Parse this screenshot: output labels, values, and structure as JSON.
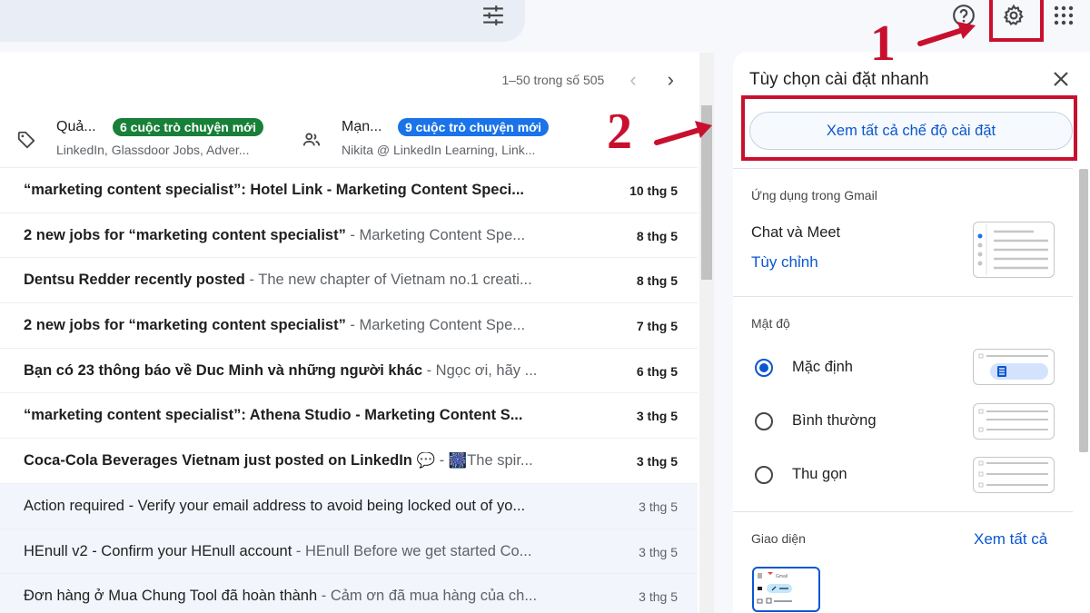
{
  "toolbar": {
    "icons": [
      "tune-icon",
      "help-icon",
      "gear-icon",
      "apps-icon"
    ]
  },
  "annotations": {
    "step1": "1",
    "step2": "2",
    "color": "#c8102e"
  },
  "mail": {
    "pager": "1–50 trong số 505",
    "categories": [
      {
        "icon": "tag-icon",
        "title": "Quả...",
        "badge": "6 cuộc trò chuyện mới",
        "badge_color": "#188038",
        "sub": "LinkedIn, Glassdoor Jobs, Adver..."
      },
      {
        "icon": "people-icon",
        "title": "Mạn...",
        "badge": "9 cuộc trò chuyện mới",
        "badge_color": "#1a73e8",
        "sub": "Nikita @ LinkedIn Learning, Link..."
      }
    ],
    "rows": [
      {
        "subject": "“marketing content specialist”: Hotel Link - Marketing Content Speci...",
        "snippet": "",
        "date": "10 thg 5",
        "unread": true
      },
      {
        "subject": "2 new jobs for “marketing content specialist”",
        "snippet": " - Marketing Content Spe...",
        "date": "8 thg 5",
        "unread": true
      },
      {
        "subject": "Dentsu Redder recently posted",
        "snippet": " - The new chapter of Vietnam no.1 creati...",
        "date": "8 thg 5",
        "unread": true
      },
      {
        "subject": "2 new jobs for “marketing content specialist”",
        "snippet": " - Marketing Content Spe...",
        "date": "7 thg 5",
        "unread": true
      },
      {
        "subject": "Bạn có 23 thông báo về Duc Minh và những người khác",
        "snippet": " - Ngọc ơi, hãy ...",
        "date": "6 thg 5",
        "unread": true
      },
      {
        "subject": "“marketing content specialist”: Athena Studio - Marketing Content S...",
        "snippet": "",
        "date": "3 thg 5",
        "unread": true
      },
      {
        "subject": "Coca-Cola Beverages Vietnam just posted on LinkedIn 💬",
        "snippet": " - 🎆The spir...",
        "date": "3 thg 5",
        "unread": true
      },
      {
        "subject": "Action required - Verify your email address to avoid being locked out of yo...",
        "snippet": "",
        "date": "3 thg 5",
        "unread": false
      },
      {
        "subject": "HEnull v2 - Confirm your HEnull account",
        "snippet": " - HEnull Before we get started Co...",
        "date": "3 thg 5",
        "unread": false
      },
      {
        "subject": "Đơn hàng ở Mua Chung Tool đã hoàn thành",
        "snippet": " - Cảm ơn đã mua hàng của ch...",
        "date": "3 thg 5",
        "unread": false
      }
    ]
  },
  "quick_settings": {
    "title": "Tùy chọn cài đặt nhanh",
    "see_all_settings": "Xem tất cả chế độ cài đặt",
    "apps_section": "Ứng dụng trong Gmail",
    "chat_meet": "Chat và Meet",
    "customize": "Tùy chỉnh",
    "density_section": "Mật độ",
    "density_options": [
      {
        "label": "Mặc định",
        "selected": true
      },
      {
        "label": "Bình thường",
        "selected": false
      },
      {
        "label": "Thu gọn",
        "selected": false
      }
    ],
    "theme_section": "Giao diện",
    "see_all": "Xem tất cả",
    "theme_thumb_label": "Gmail"
  }
}
